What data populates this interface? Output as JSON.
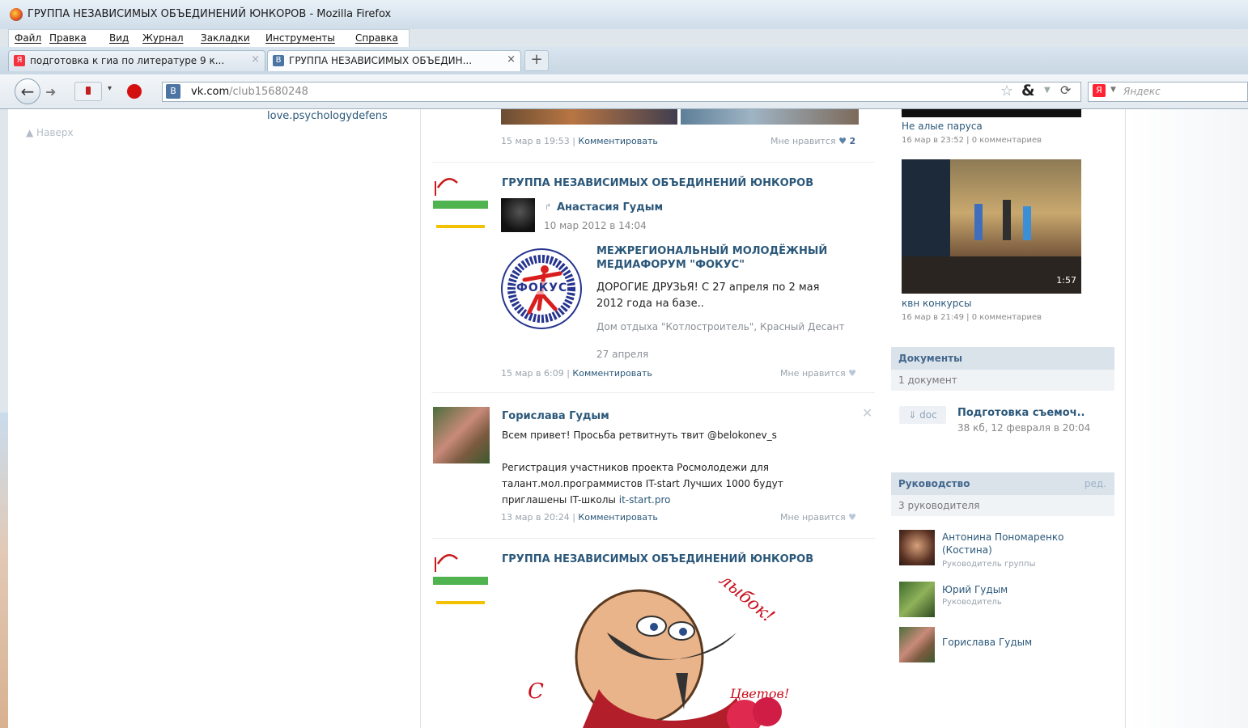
{
  "window": {
    "title": "ГРУППА НЕЗАВИСИМЫХ ОБЪЕДИНЕНИЙ ЮНКОРОВ - Mozilla Firefox"
  },
  "menu": [
    "Файл",
    "Правка",
    "Вид",
    "Журнал",
    "Закладки",
    "Инструменты",
    "Справка"
  ],
  "tabs": [
    {
      "label": "подготовка к гиа по литературе 9 к...",
      "favicon": "yandex-favicon",
      "close": "×"
    },
    {
      "label": "ГРУППА НЕЗАВИСИМЫХ ОБЪЕДИН...",
      "favicon": "vk-favicon",
      "close": "×"
    }
  ],
  "new_tab": "+",
  "address": {
    "favicon_letter": "В",
    "domain": "vk.com",
    "path": "/club15680248"
  },
  "search": {
    "placeholder": "Яндекс",
    "engine_letter": "Я"
  },
  "left": {
    "naverh": "▲ Наверх",
    "love_link": "love.psychologydefens"
  },
  "posts": {
    "post0": {
      "date": "15 мар в 19:53",
      "comment": "Комментировать",
      "like": "Мне нравится",
      "like_count": "2"
    },
    "post1": {
      "author": "ГРУППА НЕЗАВИСИМЫХ ОБЪЕДИНЕНИЙ ЮНКОРОВ",
      "repost_author": "Анастасия Гудым",
      "repost_date": "10 мар 2012 в 14:04",
      "event_title": "МЕЖРЕГИОНАЛЬНЫЙ МОЛОДЁЖНЫЙ МЕДИАФОРУМ \"ФОКУС\"",
      "event_text": "ДОРОГИЕ ДРУЗЬЯ! С 27 апреля по 2 мая 2012 года на базе..",
      "event_place": "Дом отдыха \"Котлостроитель\", Красный Десант",
      "event_date": "27 апреля",
      "logo_text": "ФОКУС",
      "date": "15 мар в 6:09",
      "comment": "Комментировать",
      "like": "Мне нравится"
    },
    "post2": {
      "author": "Горислава Гудым",
      "text1": "Всем привет! Просьба ретвитнуть твит @belokonev_s",
      "text2": "Регистрация участников проекта Росмолодежи для талант.мол.программистов IT-start Лучших 1000 будут приглашены IT-школы",
      "link": "it-start.pro",
      "date": "13 мар в 20:24",
      "comment": "Комментировать",
      "like": "Мне нравится"
    },
    "post3": {
      "author": "ГРУППА НЕЗАВИСИМЫХ ОБЪЕДИНЕНИЙ ЮНКОРОВ",
      "card_word1": "Улыбок!",
      "card_word2": "С",
      "card_word3": "Цветов!"
    }
  },
  "right": {
    "video1": {
      "title": "Не алые паруса",
      "meta": "16 мар в 23:52 | 0 комментариев"
    },
    "video2": {
      "title": "квн конкурсы",
      "meta": "16 мар в 21:49 | 0 комментариев",
      "duration": "1:57"
    },
    "documents": {
      "title": "Документы",
      "count": "1 документ",
      "doc_badge": "doc",
      "doc_name": "Подготовка съемоч..",
      "doc_meta": "38 кб, 12 февраля в 20:04"
    },
    "leaders": {
      "title": "Руководство",
      "edit": "ред.",
      "count": "3 руководителя",
      "items": [
        {
          "name": "Антонина Пономаренко (Костина)",
          "role": "Руководитель группы"
        },
        {
          "name": "Юрий Гудым",
          "role": "Руководитель"
        },
        {
          "name": "Горислава Гудым",
          "role": ""
        }
      ]
    }
  },
  "colors": {
    "vk_link": "#2b587a",
    "vk_header": "#45688e",
    "accent_red": "#d40f0f"
  }
}
